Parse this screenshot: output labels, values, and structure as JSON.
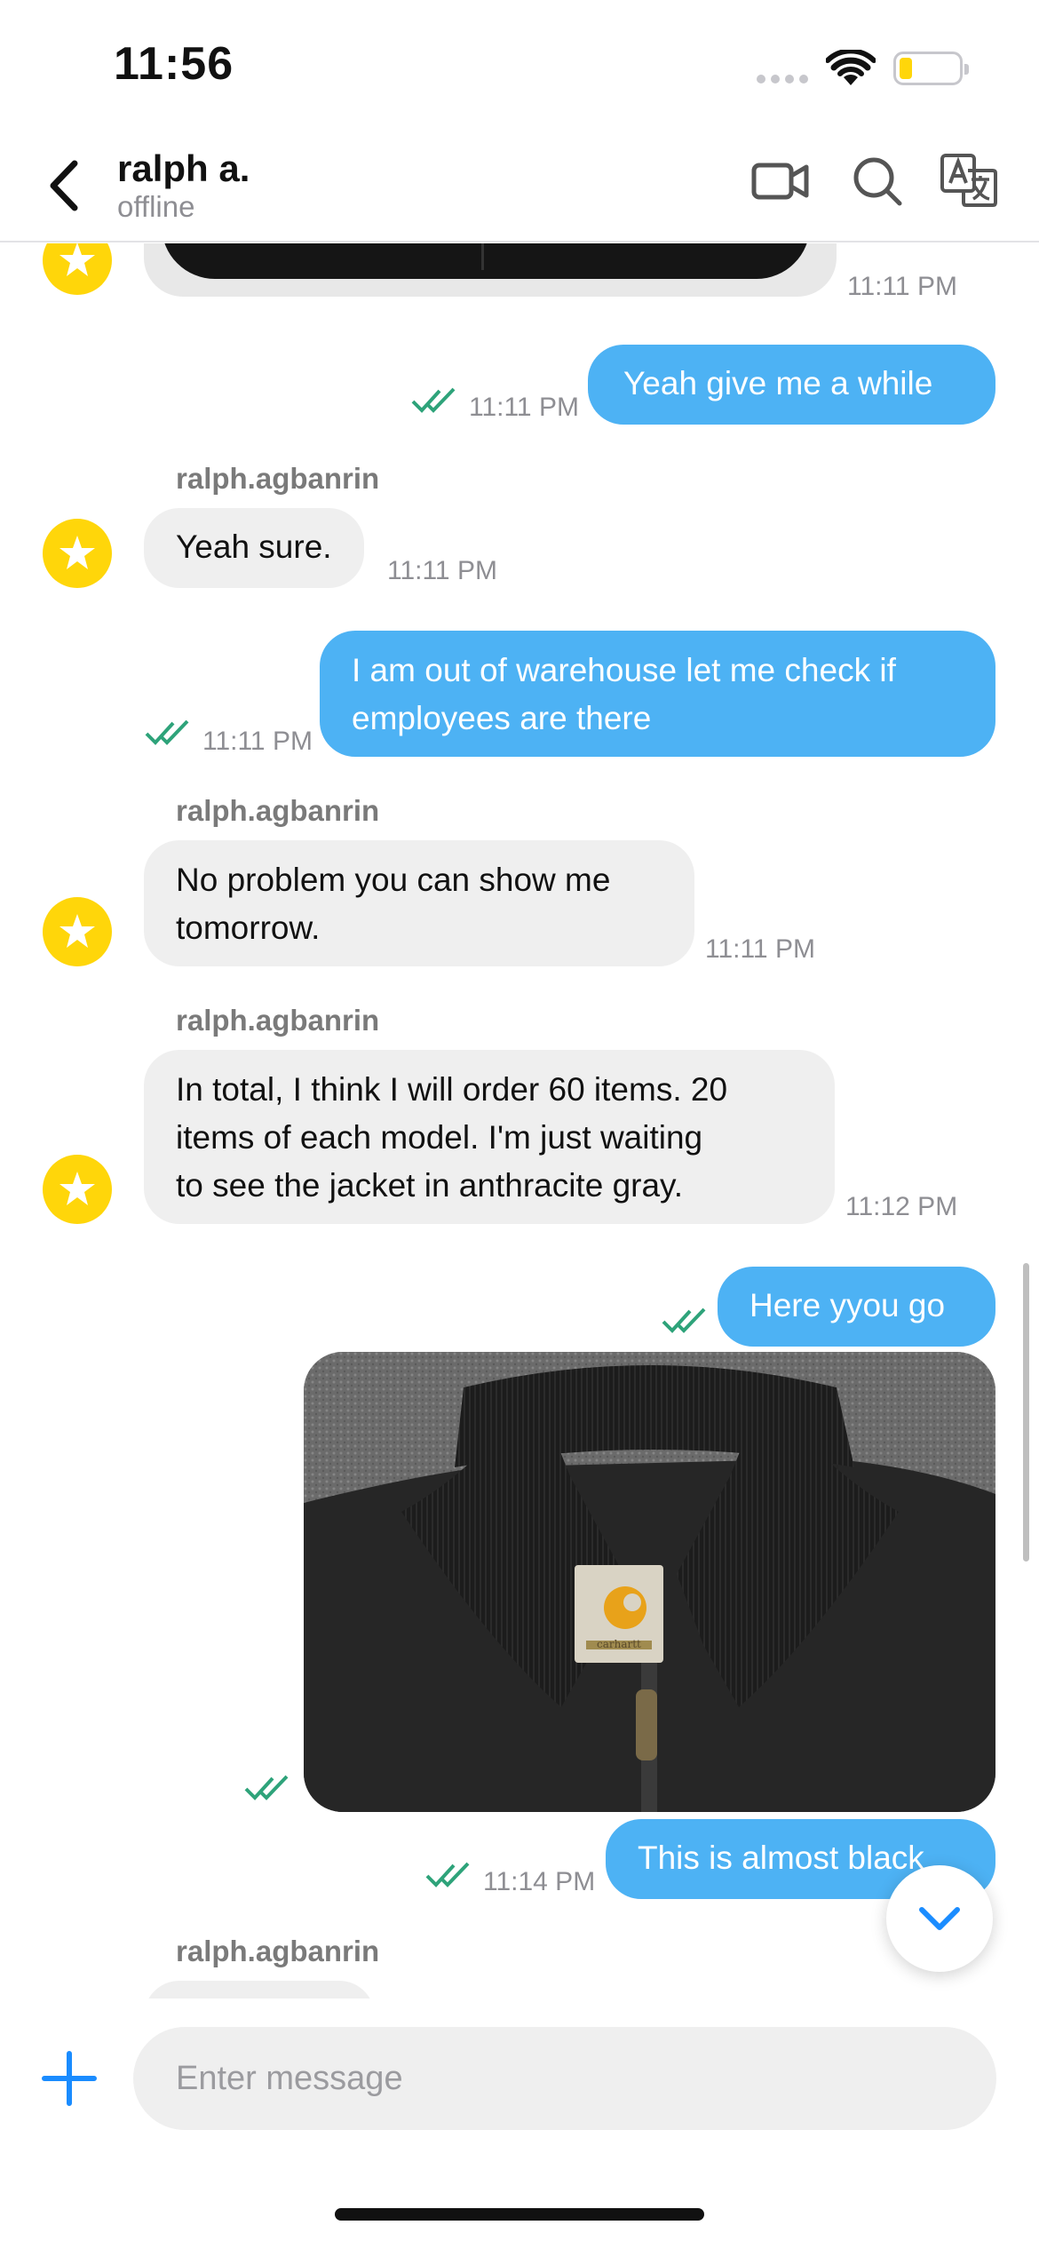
{
  "status_bar": {
    "time": "11:56"
  },
  "header": {
    "name": "ralph a.",
    "status": "offline"
  },
  "messages": {
    "m0_time": "11:11 PM",
    "m1": {
      "text": "Yeah give me a while",
      "time": "11:11 PM"
    },
    "m2": {
      "sender": "ralph.agbanrin",
      "text": "Yeah sure.",
      "time": "11:11 PM"
    },
    "m3": {
      "text_line1": "I am out of warehouse let me check if",
      "text_line2": "employees are there",
      "time": "11:11 PM"
    },
    "m4": {
      "sender": "ralph.agbanrin",
      "text_line1": "No problem you can show me",
      "text_line2": "tomorrow.",
      "time": "11:11 PM"
    },
    "m5": {
      "sender": "ralph.agbanrin",
      "text_line1": "In total, I think I will order 60 items. 20",
      "text_line2": "items of each model. I'm just waiting",
      "text_line3": "to see the jacket in anthracite gray.",
      "time": "11:12 PM"
    },
    "m6": {
      "text": "Here yyou go"
    },
    "m7": {
      "label": "carhartt"
    },
    "m8": {
      "text": "This is almost black",
      "time": "11:14 PM"
    },
    "m9": {
      "sender": "ralph.agbanrin"
    }
  },
  "composer": {
    "placeholder": "Enter message"
  },
  "colors": {
    "outgoing_bubble": "#4db2f4",
    "incoming_bubble": "#efefef",
    "avatar": "#ffd60a",
    "read_ticks": "#2ea37a",
    "accent": "#1a8cff"
  },
  "icons": {
    "back": "chevron-left-icon",
    "video": "video-camera-icon",
    "search": "search-icon",
    "translate": "translate-icon",
    "plus": "plus-icon",
    "scroll_down": "chevron-down-icon"
  }
}
